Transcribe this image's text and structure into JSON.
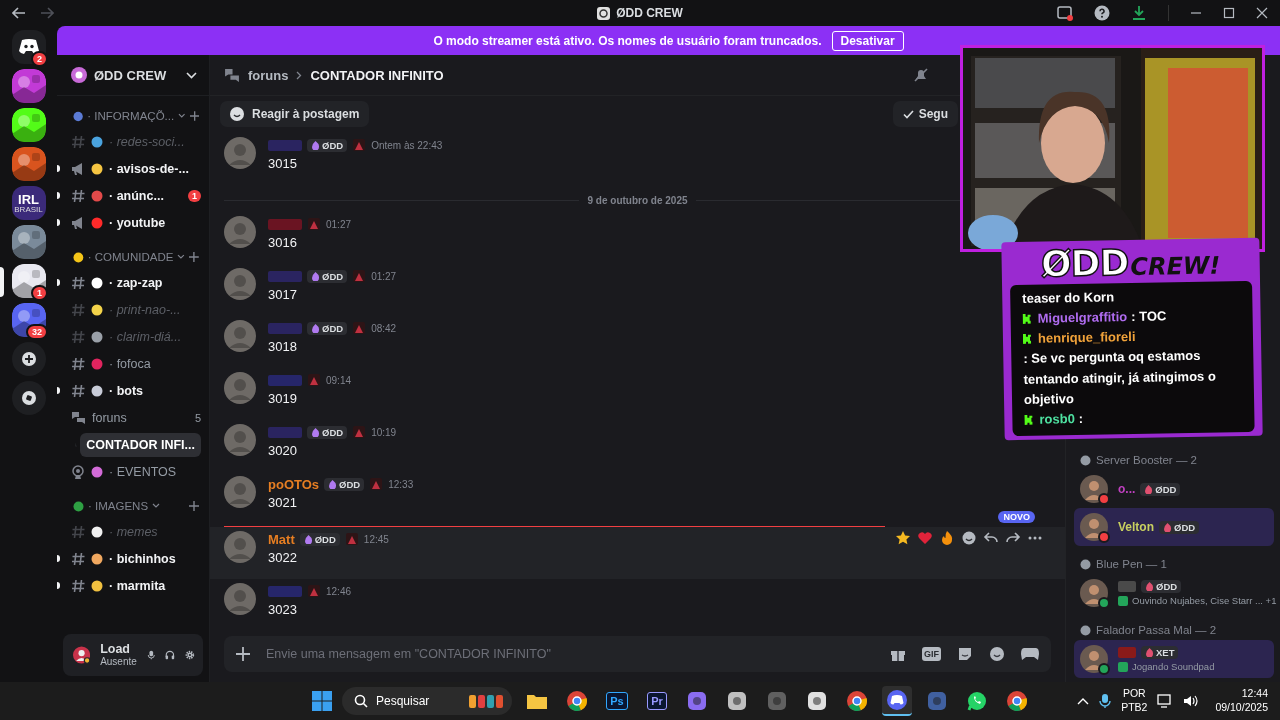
{
  "window": {
    "title": "ØDD CREW"
  },
  "banner": {
    "text": "O modo streamer está ativo. Os nomes de usuário foram truncados.",
    "button": "Desativar"
  },
  "servers": [
    {
      "kind": "home",
      "badge": "2",
      "selected": false
    },
    {
      "kind": "picture",
      "color": "#c23ad6",
      "selected": false
    },
    {
      "kind": "picture",
      "color": "#53fc18",
      "selected": false
    },
    {
      "kind": "picture",
      "color": "#d9541e",
      "selected": false
    },
    {
      "kind": "text",
      "label": "IRL",
      "sublabel": "BRASIL",
      "color": "#3b2a7a",
      "selected": false
    },
    {
      "kind": "picture",
      "color": "#7a8a9a",
      "selected": false
    },
    {
      "kind": "picture",
      "color": "#e8e8f0",
      "badge": "1",
      "selected": true
    },
    {
      "kind": "picture",
      "color": "#5865f2",
      "badge": "32",
      "selected": false
    }
  ],
  "server_name": "ØDD CREW",
  "categories": [
    {
      "name": "· INFORMAÇÕ...",
      "color": "#5b7bd5",
      "channels": [
        {
          "kind": "text",
          "name": "· redes-soci...",
          "color": "#4aa3df",
          "unread": false,
          "muted": true
        },
        {
          "kind": "announce",
          "name": "· avisos-de-...",
          "color": "#f5c542",
          "unread": true,
          "muted": false
        },
        {
          "kind": "text",
          "name": "· anúnc...",
          "color": "#e34a4a",
          "unread": true,
          "muted": false,
          "badge": "1"
        },
        {
          "kind": "announce",
          "name": "· youtube",
          "color": "#ff2a2a",
          "unread": true,
          "muted": false
        }
      ]
    },
    {
      "name": "· COMUNIDADE",
      "color": "#f5c518",
      "channels": [
        {
          "kind": "text",
          "name": "· zap-zap",
          "color": "#ffffff",
          "unread": true,
          "muted": false
        },
        {
          "kind": "text",
          "name": "· print-nao-...",
          "color": "#f3d34a",
          "unread": false,
          "muted": true
        },
        {
          "kind": "text",
          "name": "· clarim-diá...",
          "color": "#9aa0a8",
          "unread": false,
          "muted": true
        },
        {
          "kind": "text",
          "name": "· fofoca",
          "color": "#e0245e",
          "unread": false,
          "muted": false
        },
        {
          "kind": "text",
          "name": "· bots",
          "color": "#c8ccd8",
          "unread": true,
          "muted": false
        },
        {
          "kind": "forum",
          "name": "foruns",
          "count": "5",
          "unread": false,
          "muted": false
        },
        {
          "kind": "thread",
          "name": "CONTADOR INFI...",
          "selected": true
        },
        {
          "kind": "stage",
          "name": "· EVENTOS",
          "color": "#d36bd8",
          "unread": false,
          "muted": false
        }
      ]
    },
    {
      "name": "· IMAGENS",
      "color": "#2ea043",
      "channels": [
        {
          "kind": "text",
          "name": "· memes",
          "color": "#f0f0f0",
          "unread": false,
          "muted": true
        },
        {
          "kind": "text",
          "name": "· bichinhos",
          "color": "#f0a860",
          "unread": true,
          "muted": false
        },
        {
          "kind": "text",
          "name": "· marmita",
          "color": "#f0c040",
          "unread": true,
          "muted": false
        }
      ]
    }
  ],
  "user": {
    "name": "Load",
    "status": "Ausente"
  },
  "header": {
    "parent": "foruns",
    "title": "CONTADOR INFINITO",
    "react": "Reagir à postagem",
    "follow": "Segu"
  },
  "messages": [
    {
      "color": "#2a2460",
      "tag": "ØDD",
      "time": "Ontem às 22:43",
      "text": "3015",
      "hovered": false
    },
    {
      "color": "#6a1422",
      "time": "01:27",
      "text": "3016",
      "hovered": false,
      "date_before": "9 de outubro de 2025"
    },
    {
      "color": "#2a2460",
      "tag": "ØDD",
      "time": "01:27",
      "text": "3017",
      "hovered": false
    },
    {
      "color": "#2a2460",
      "tag": "ØDD",
      "time": "08:42",
      "text": "3018",
      "hovered": false
    },
    {
      "color": "#26266a",
      "time": "09:14",
      "text": "3019",
      "hovered": false
    },
    {
      "color": "#2a2460",
      "tag": "ØDD",
      "time": "10:19",
      "text": "3020",
      "hovered": false
    },
    {
      "author": "poOTOs",
      "color": "#e67e22",
      "tag": "ØDD",
      "time": "12:33",
      "text": "3021",
      "hovered": false
    },
    {
      "author": "Matt",
      "color": "#e67e22",
      "tag": "ØDD",
      "time": "12:45",
      "text": "3022",
      "hovered": true,
      "new_before": "NOVO"
    },
    {
      "color": "#26266a",
      "time": "12:46",
      "text": "3023",
      "hovered": false
    }
  ],
  "composer": {
    "placeholder": "Envie uma mensagem em \"CONTADOR INFINITO\"",
    "gif": "GIF"
  },
  "overlay": {
    "logo": "ØDD",
    "logo_suffix": "CREW!",
    "lines": [
      {
        "text": "teaser do Korn"
      },
      {
        "user": "Miguelgraffitio",
        "color": "#b06cf0",
        "text": ": TOC"
      },
      {
        "user": "henrique_fioreli",
        "color": "#f0a23a",
        "text": ": Se vc pergunta oq estamos tentando atingir, já atingimos o objetivo"
      },
      {
        "user": "rosb0",
        "color": "#4ee0a0",
        "text": ":"
      }
    ]
  },
  "member_groups": [
    {
      "title": "Server Booster — 2",
      "members": [
        {
          "name": "o...",
          "color": "#c040c0",
          "tag": "ØDD",
          "online": false,
          "highlighted": false
        },
        {
          "name": "Velton",
          "color": "#c8d060",
          "tag": "ØDD",
          "online": false,
          "highlighted": true
        }
      ]
    },
    {
      "title": "Blue Pen — 1",
      "members": [
        {
          "color": "#4a4a4a",
          "tag": "ØDD",
          "online": true,
          "activity": "Ouvindo Nujabes, Cise Starr ... +1",
          "highlighted": false
        }
      ]
    },
    {
      "title": "Falador Passa Mal — 2",
      "members": [
        {
          "color": "#8a1a1a",
          "tag": "XET",
          "online": true,
          "activity": "Jogando Soundpad",
          "highlighted": true
        }
      ]
    }
  ],
  "taskbar": {
    "search": "Pesquisar",
    "apps": [
      {
        "kind": "folder",
        "selected": false
      },
      {
        "kind": "browser",
        "selected": false
      },
      {
        "kind": "label",
        "label": "Ps",
        "color": "#31a8ff",
        "selected": false
      },
      {
        "kind": "label",
        "label": "Pr",
        "color": "#9999ff",
        "selected": false
      },
      {
        "kind": "generic",
        "color": "#8a6cf0",
        "selected": false
      },
      {
        "kind": "generic",
        "color": "#c0c0c0",
        "selected": false
      },
      {
        "kind": "generic",
        "color": "#606060",
        "selected": false
      },
      {
        "kind": "generic",
        "color": "#e0e0e0",
        "selected": false
      },
      {
        "kind": "browser",
        "selected": false
      },
      {
        "kind": "discord",
        "selected": true
      },
      {
        "kind": "generic",
        "color": "#4060a0",
        "selected": false
      },
      {
        "kind": "whatsapp",
        "selected": false
      },
      {
        "kind": "browser",
        "selected": false
      }
    ],
    "lang": "POR",
    "layout": "PTB2",
    "time": "12:44",
    "date": "09/10/2025"
  }
}
